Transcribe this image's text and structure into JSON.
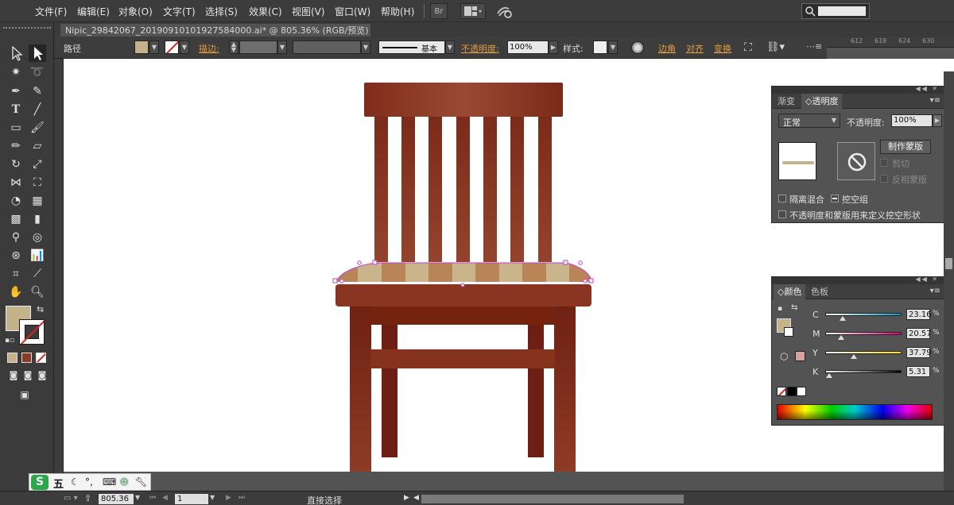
{
  "menubar": {
    "items": [
      "文件(F)",
      "编辑(E)",
      "对象(O)",
      "文字(T)",
      "选择(S)",
      "效果(C)",
      "视图(V)",
      "窗口(W)",
      "帮助(H)"
    ],
    "bridge_label": "Br"
  },
  "document": {
    "tab_title": "Nipic_29842067_20190910101927584000.ai* @ 805.36% (RGB/预览)"
  },
  "rulers": {
    "top_ticks": [
      "612",
      "618",
      "624",
      "630"
    ]
  },
  "control_bar": {
    "selection_label": "路径",
    "stroke_label": "描边:",
    "brush_label": "基本",
    "opacity_label": "不透明度:",
    "opacity_value": "100%",
    "style_label": "样式:",
    "corner_label": "边角",
    "align_label": "对齐",
    "transform_label": "变换",
    "fill_color": "#c3b38a"
  },
  "transparency_panel": {
    "tabs": [
      "渐变",
      "透明度"
    ],
    "blend_mode": "正常",
    "opacity_label": "不透明度:",
    "opacity_value": "100%",
    "make_mask_button": "制作蒙版",
    "clip_label": "剪切",
    "invert_mask_label": "反相蒙版",
    "isolate_blend_label": "隔离混合",
    "knockout_group_label": "挖空组",
    "opacity_mask_knockout_label": "不透明度和蒙版用来定义挖空形状"
  },
  "color_panel": {
    "tabs": [
      "颜色",
      "色板"
    ],
    "channels": [
      {
        "name": "C",
        "value": "23.16",
        "fraction": 0.23
      },
      {
        "name": "M",
        "value": "20.57",
        "fraction": 0.21
      },
      {
        "name": "Y",
        "value": "37.79",
        "fraction": 0.38
      },
      {
        "name": "K",
        "value": "5.31",
        "fraction": 0.05
      }
    ],
    "percent_sign": "%",
    "fill_color": "#c3b38a",
    "out_of_gamut_color": "#d9a0a0"
  },
  "statusbar": {
    "zoom": "805.36",
    "page": "1",
    "status_text": "直接选择"
  },
  "ime": {
    "logo": "S",
    "mode": "五"
  },
  "artwork": {
    "chair_wood_color": "#8a3a25",
    "seat_stripe_light": "#c9b48c",
    "seat_stripe_dark": "#b98557",
    "anchor_color": "#c63cc6"
  }
}
